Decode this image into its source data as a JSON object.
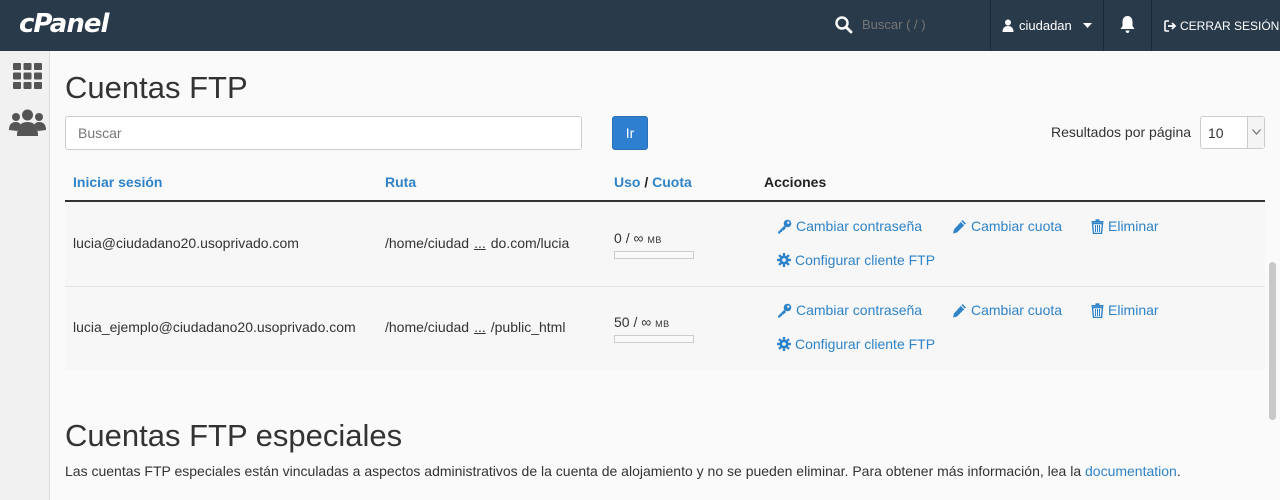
{
  "header": {
    "logo": "cPanel",
    "search_placeholder": "Buscar ( / )",
    "username": "ciudadan",
    "logout_label": "CERRAR SESIÓN"
  },
  "page": {
    "title": "Cuentas FTP",
    "search_placeholder": "Buscar",
    "go_label": "Ir",
    "per_page_label": "Resultados por página",
    "per_page_value": "10"
  },
  "table": {
    "columns": {
      "login": "Iniciar sesión",
      "path": "Ruta",
      "usage": "Uso",
      "separator": "/",
      "quota": "Cuota",
      "actions": "Acciones"
    },
    "rows": [
      {
        "login": "lucia@ciudadano20.usoprivado.com",
        "path_start": "/home/ciudad",
        "path_ellipsis": "...",
        "path_end": "do.com/lucia",
        "usage": "0",
        "quota": "∞",
        "unit": "MB",
        "usage_fraction": 0
      },
      {
        "login": "lucia_ejemplo@ciudadano20.usoprivado.com",
        "path_start": "/home/ciudad",
        "path_ellipsis": "...",
        "path_end": "/public_html",
        "usage": "50",
        "quota": "∞",
        "unit": "MB",
        "usage_fraction": 0
      }
    ],
    "actions": {
      "change_password": "Cambiar contraseña",
      "change_quota": "Cambiar cuota",
      "delete": "Eliminar",
      "configure_client": "Configurar cliente FTP"
    }
  },
  "special": {
    "title": "Cuentas FTP especiales",
    "description": "Las cuentas FTP especiales están vinculadas a aspectos administrativos de la cuenta de alojamiento y no se pueden eliminar. Para obtener más información, lea la",
    "link": "documentation",
    "period": "."
  },
  "colors": {
    "topbar": "#293a4a",
    "accent": "#2f7fd0",
    "link": "#2f83c8"
  },
  "icons": [
    "search-icon",
    "user-icon",
    "chevron-down-icon",
    "bell-icon",
    "logout-icon",
    "grid-icon",
    "users-icon",
    "key-icon",
    "pencil-icon",
    "trash-icon",
    "gear-icon"
  ]
}
